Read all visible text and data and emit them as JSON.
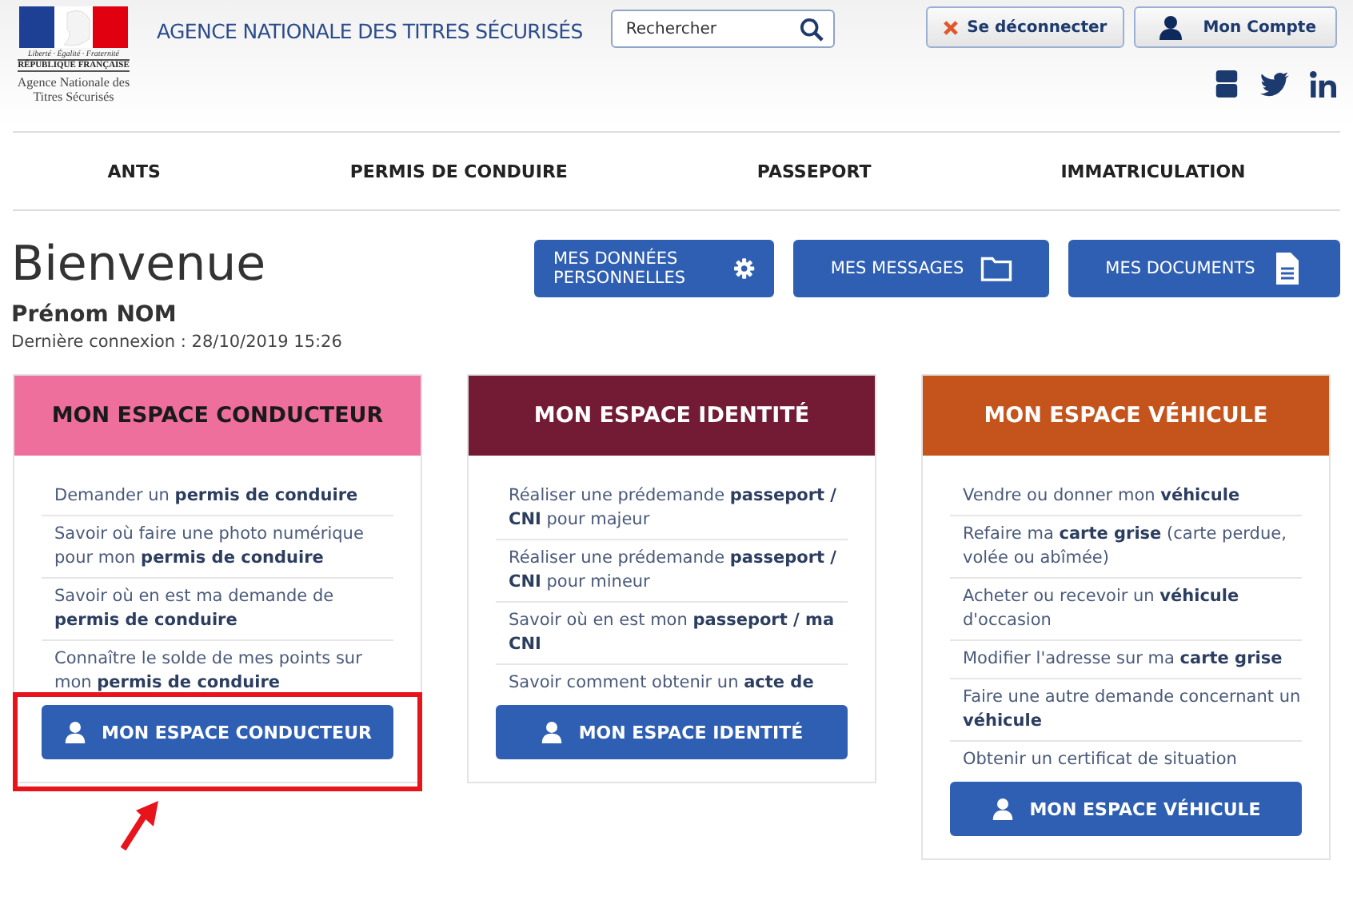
{
  "header": {
    "logo": {
      "motto": "Liberté · Égalité · Fraternité",
      "republic": "RÉPUBLIQUE FRANÇAISE",
      "agency": "Agence Nationale des Titres Sécurisés"
    },
    "title": "AGENCE NATIONALE DES TITRES SÉCURISÉS",
    "search": {
      "placeholder": "Rechercher"
    },
    "logout_button": "Se déconnecter",
    "account_button": "Mon Compte"
  },
  "nav": [
    "ANTS",
    "PERMIS DE CONDUIRE",
    "PASSEPORT",
    "IMMATRICULATION"
  ],
  "welcome": {
    "title": "Bienvenue",
    "user_name": "Prénom NOM",
    "last_login": "Dernière connexion : 28/10/2019 15:26"
  },
  "actions": [
    {
      "label": "MES DONNÉES PERSONNELLES",
      "kind": "gear"
    },
    {
      "label": "MES MESSAGES",
      "kind": "folder"
    },
    {
      "label": "MES DOCUMENTS",
      "kind": "document"
    }
  ],
  "spaces": [
    {
      "title": "MON ESPACE CONDUCTEUR",
      "color": "#ee6f9c",
      "highlighted": true,
      "button": "MON ESPACE CONDUCTEUR",
      "links": [
        "Demander un **permis de conduire**",
        "Savoir où faire une photo numérique pour mon **permis de conduire**",
        "Savoir où en est ma demande de **permis de conduire**",
        "Connaître le solde de mes points sur mon **permis de conduire**"
      ]
    },
    {
      "title": "MON ESPACE IDENTITÉ",
      "color": "#731b35",
      "highlighted": false,
      "button": "MON ESPACE IDENTITÉ",
      "links": [
        "Réaliser une prédemande **passeport / CNI** pour majeur",
        "Réaliser une prédemande **passeport / CNI** pour mineur",
        "Savoir où en est mon **passeport / ma CNI**",
        "Savoir comment obtenir un **acte de**"
      ]
    },
    {
      "title": "MON ESPACE VÉHICULE",
      "color": "#c4541c",
      "highlighted": false,
      "button": "MON ESPACE VÉHICULE",
      "links": [
        "Vendre ou donner mon **véhicule**",
        "Refaire ma **carte grise** (carte perdue, volée ou abîmée)",
        "Acheter ou recevoir un **véhicule** d'occasion",
        "Modifier l'adresse sur ma **carte grise**",
        "Faire une autre demande concernant un **véhicule**",
        "Obtenir un certificat de situation"
      ]
    }
  ]
}
